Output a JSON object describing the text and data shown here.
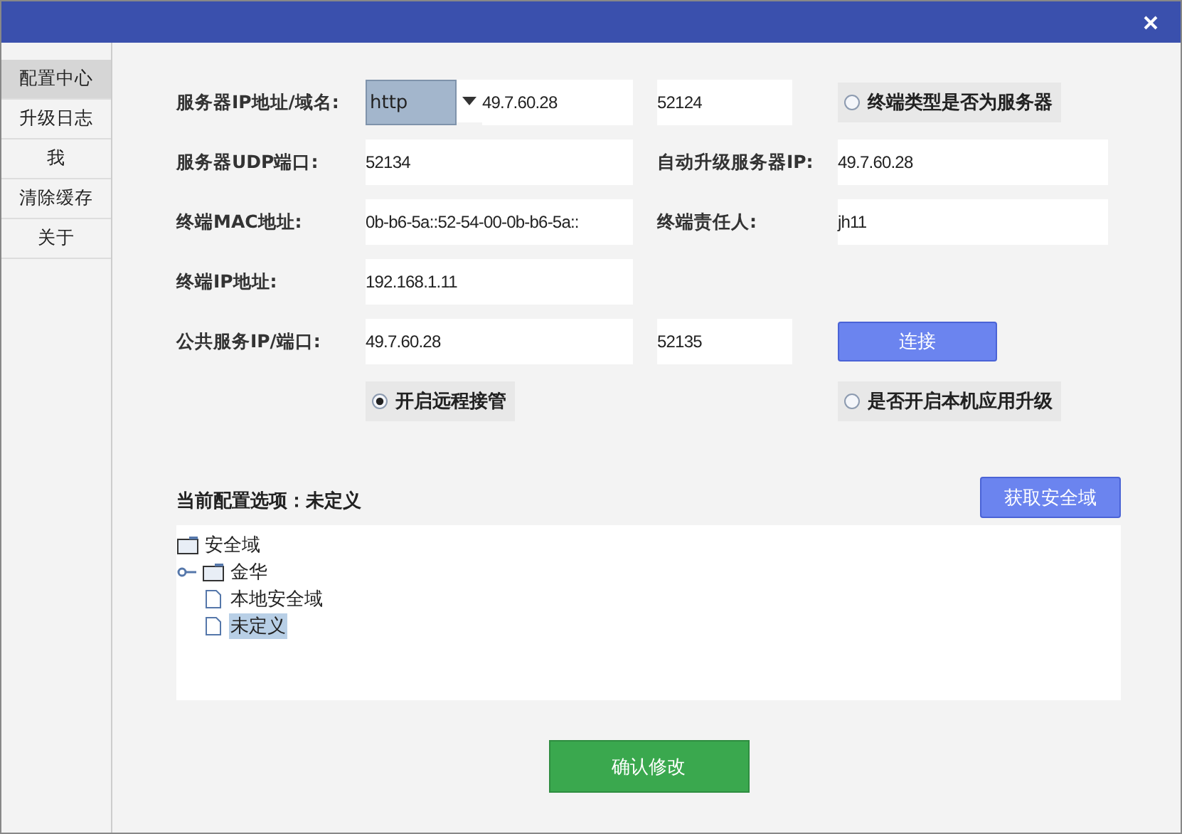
{
  "sidebar": {
    "items": [
      {
        "label": "配置中心",
        "selected": true
      },
      {
        "label": "升级日志",
        "selected": false
      },
      {
        "label": "我",
        "selected": false
      },
      {
        "label": "清除缓存",
        "selected": false
      },
      {
        "label": "关于",
        "selected": false
      }
    ]
  },
  "form": {
    "server_label": "服务器IP地址/域名:",
    "protocol": "http",
    "server_ip": "49.7.60.28",
    "server_port": "52124",
    "server_type": {
      "label": "终端类型是否为服务器",
      "checked": false
    },
    "udp_label": "服务器UDP端口:",
    "udp_port": "52134",
    "upgrade_label": "自动升级服务器IP:",
    "upgrade_ip": "49.7.60.28",
    "mac_label": "终端MAC地址:",
    "mac": "0b-b6-5a::52-54-00-0b-b6-5a::",
    "owner_label": "终端责任人:",
    "owner": "jh11",
    "ip_label": "终端IP地址:",
    "ip": "192.168.1.11",
    "public_label": "公共服务IP/端口:",
    "public_ip": "49.7.60.28",
    "public_port": "52135",
    "connect_button": "连接",
    "remote": {
      "label": "开启远程接管",
      "checked": true
    },
    "local_upgrade": {
      "label": "是否开启本机应用升级",
      "checked": false
    }
  },
  "config": {
    "current_label": "当前配置选项：未定义",
    "fetch_button": "获取安全域",
    "tree": [
      {
        "label": "安全域",
        "kind": "folder",
        "selected": false,
        "children": [
          {
            "label": "金华",
            "kind": "folder",
            "expanded": false,
            "selected": false
          },
          {
            "label": "本地安全域",
            "kind": "file",
            "selected": false
          },
          {
            "label": "未定义",
            "kind": "file",
            "selected": true
          }
        ]
      }
    ]
  },
  "confirm_button": "确认修改"
}
